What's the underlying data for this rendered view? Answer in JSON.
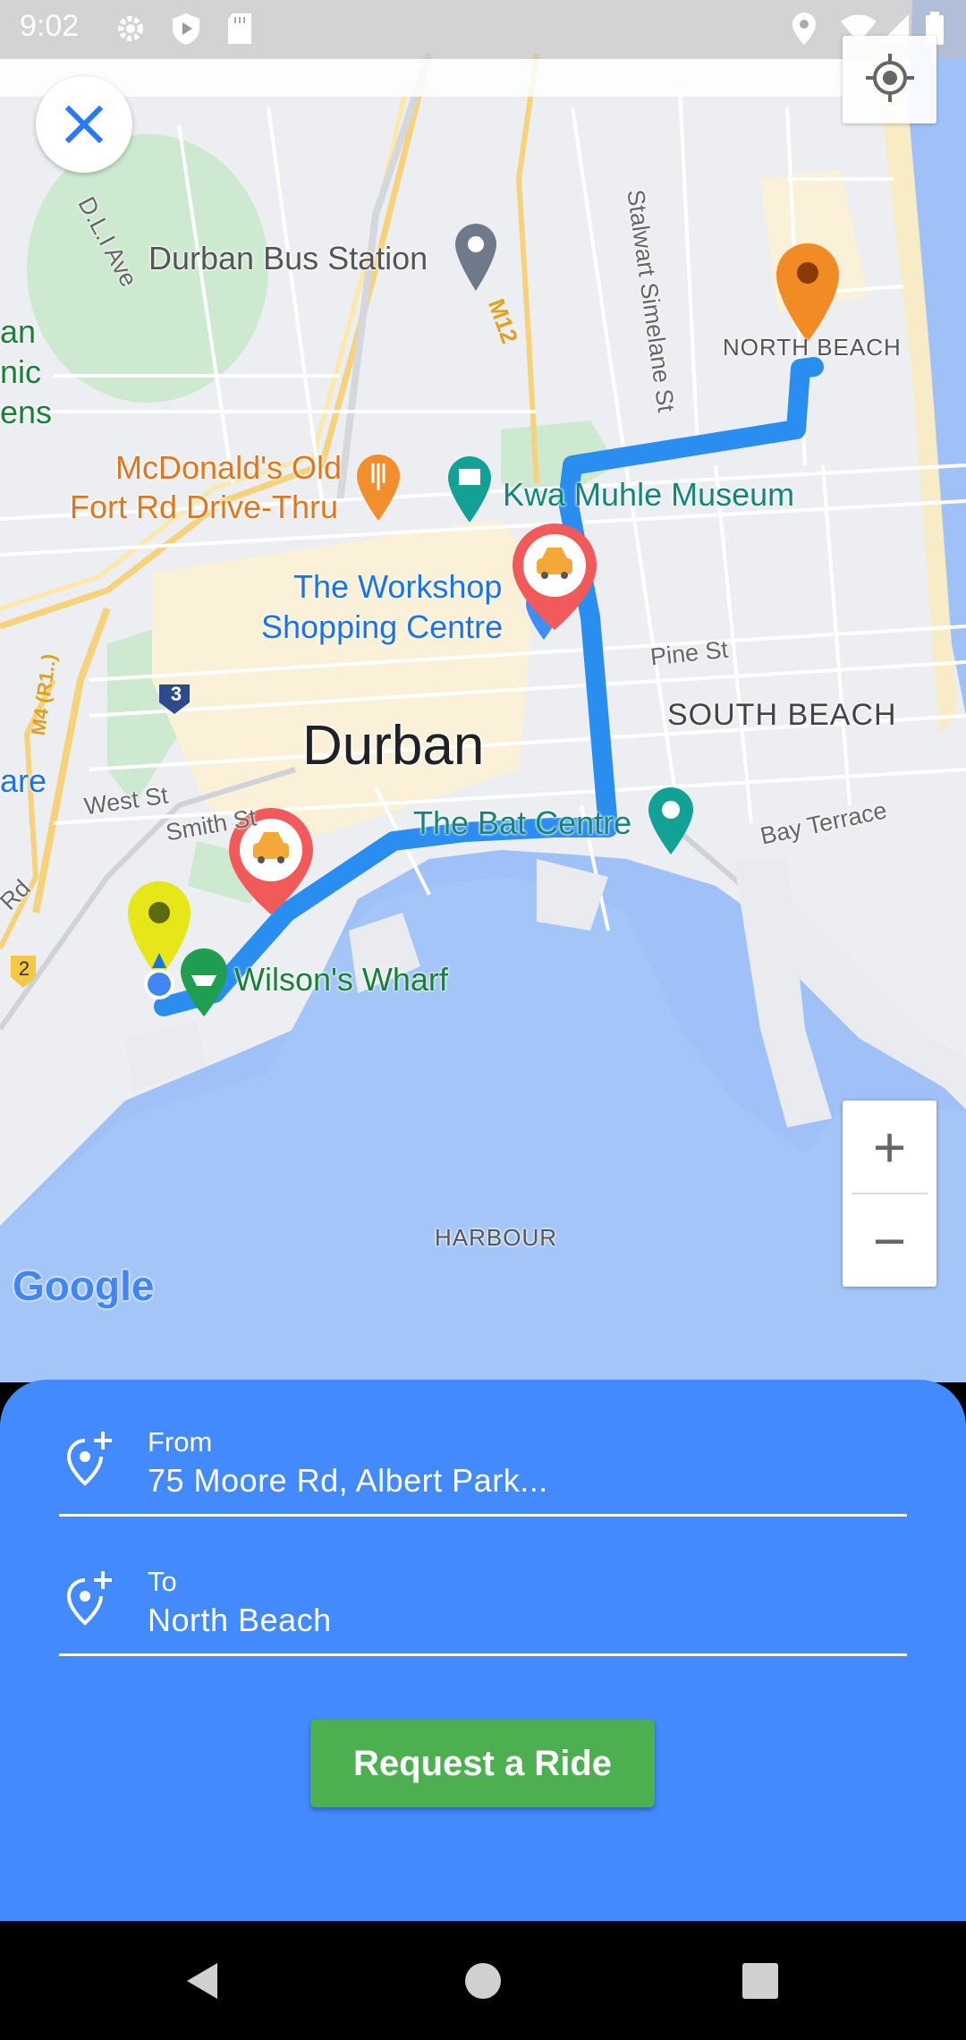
{
  "status_bar": {
    "time": "9:02"
  },
  "map": {
    "labels": {
      "bus_station": "Durban Bus Station",
      "street_dli": "D.L.I Ave",
      "road_m12": "M12",
      "street_stalwart": "Stalwart Simelane St",
      "north_beach": "NORTH BEACH",
      "mcdonalds_line1": "McDonald's Old",
      "mcdonalds_line2": "Fort Rd Drive-Thru",
      "museum": "Kwa Muhle Museum",
      "workshop_line1": "The Workshop",
      "workshop_line2": "Shopping Centre",
      "street_pine": "Pine St",
      "south_beach": "SOUTH BEACH",
      "city": "Durban",
      "route_3": "3",
      "street_west": "West St",
      "street_smith": "Smith St",
      "bat_centre": "The Bat Centre",
      "bay_terrace": "Bay Terrace",
      "wilsons_wharf": "Wilson's Wharf",
      "route_2": "2",
      "harbour": "HARBOUR",
      "edge_an": "an",
      "edge_nic": "nic",
      "edge_ens": "ens",
      "edge_are": "are",
      "edge_rd": "Rd",
      "edge_m4": "M4 (R1..)",
      "google": "Google"
    },
    "route_color": "#2a8df0",
    "car_marker_color": "#f05a5a",
    "destination_marker_color": "#f08c23",
    "origin_marker_color": "#e6e619"
  },
  "zoom": {
    "in_label": "+",
    "out_label": "−"
  },
  "panel": {
    "from_label": "From",
    "from_value": "75 Moore Rd, Albert Park...",
    "to_label": "To",
    "to_value": "North Beach",
    "request_button": "Request a Ride",
    "background_color": "#448aff",
    "button_color": "#4caf50"
  }
}
